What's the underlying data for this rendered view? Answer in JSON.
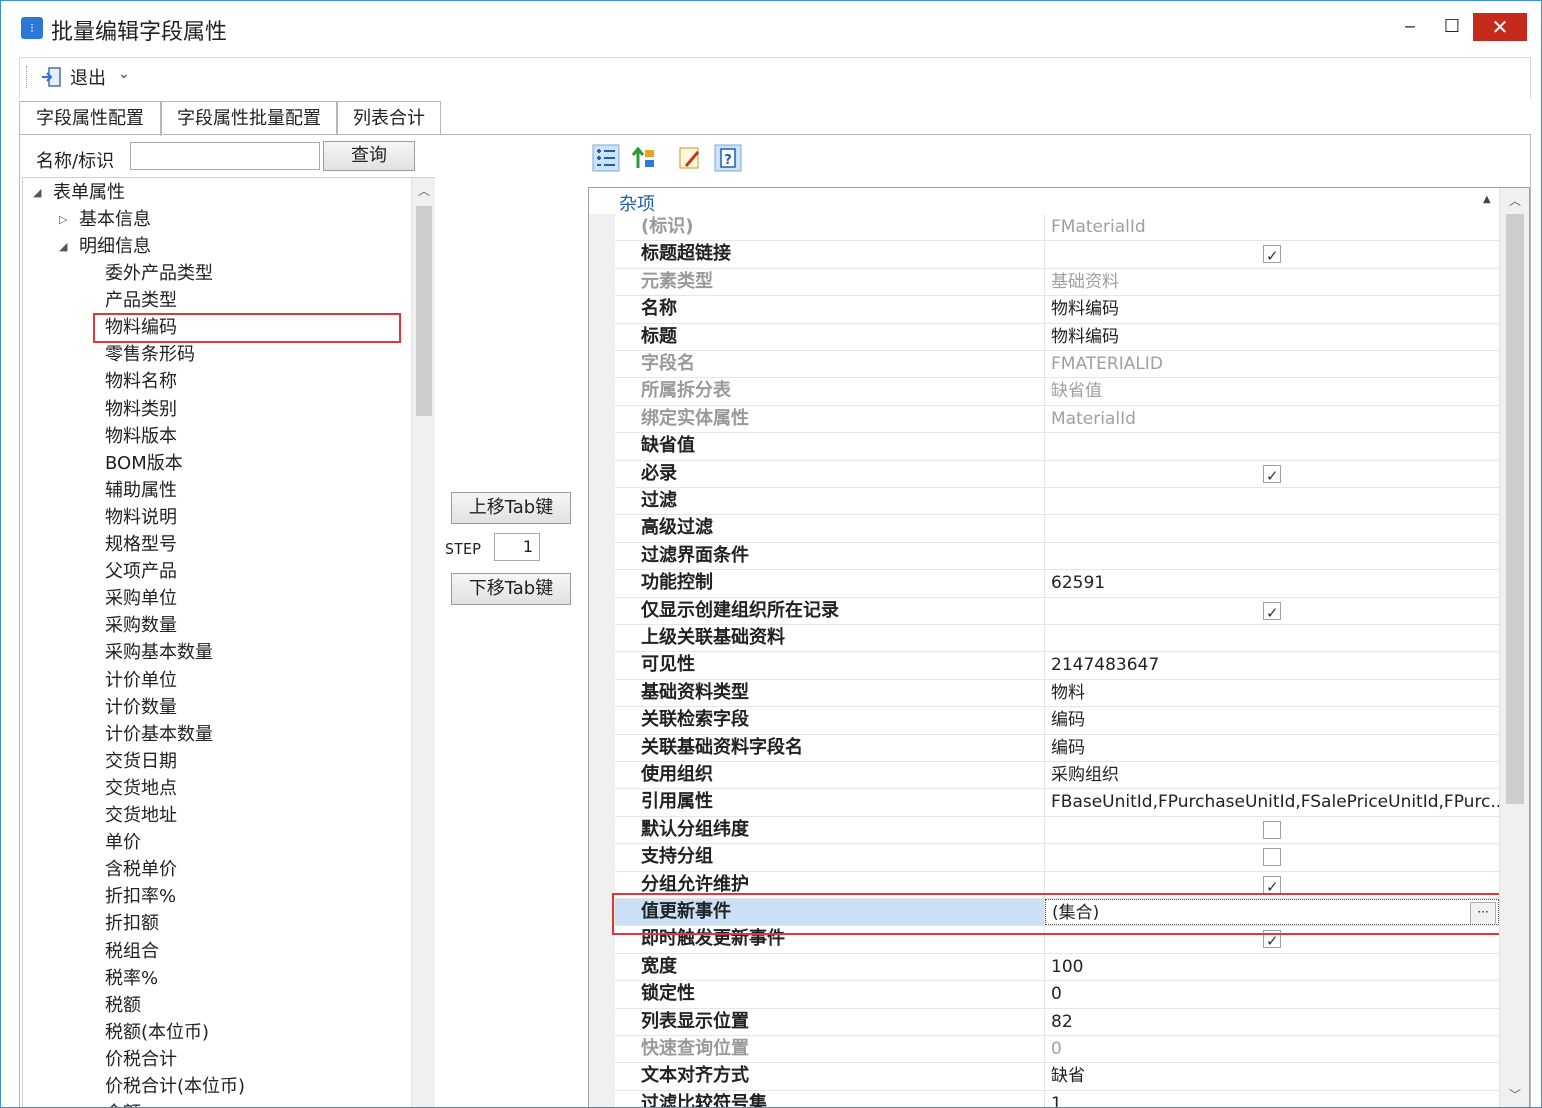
{
  "window": {
    "title": "批量编辑字段属性",
    "minimize": "‒",
    "maximize": "☐",
    "close": "✕"
  },
  "toolbar": {
    "exit_label": "退出",
    "dropdown": "⌄"
  },
  "tabs": [
    "字段属性配置",
    "字段属性批量配置",
    "列表合计"
  ],
  "search": {
    "label": "名称/标识",
    "value": "",
    "button": "查询"
  },
  "tree": {
    "root": "表单属性",
    "groups": [
      "基本信息",
      "明细信息"
    ],
    "selected": "物料编码",
    "items": [
      "委外产品类型",
      "产品类型",
      "物料编码",
      "零售条形码",
      "物料名称",
      "物料类别",
      "物料版本",
      "BOM版本",
      "辅助属性",
      "物料说明",
      "规格型号",
      "父项产品",
      "采购单位",
      "采购数量",
      "采购基本数量",
      "计价单位",
      "计价数量",
      "计价基本数量",
      "交货日期",
      "交货地点",
      "交货地址",
      "单价",
      "含税单价",
      "折扣率%",
      "折扣额",
      "税组合",
      "税率%",
      "税额",
      "税额(本位币)",
      "价税合计",
      "价税合计(本位币)",
      "金额"
    ]
  },
  "mover": {
    "up_button": "上移Tab键",
    "step_label": "STEP",
    "step_value": "1",
    "down_button": "下移Tab键"
  },
  "property_grid": {
    "category": "杂项",
    "rows": [
      {
        "name": "(标识)",
        "value": "FMaterialId",
        "disabled": true
      },
      {
        "name": "标题超链接",
        "check": true
      },
      {
        "name": "元素类型",
        "value": "基础资料",
        "disabled": true
      },
      {
        "name": "名称",
        "value": "物料编码"
      },
      {
        "name": "标题",
        "value": "物料编码"
      },
      {
        "name": "字段名",
        "value": "FMATERIALID",
        "disabled": true
      },
      {
        "name": "所属拆分表",
        "value": "缺省值",
        "disabled": true
      },
      {
        "name": "绑定实体属性",
        "value": "MaterialId",
        "disabled": true
      },
      {
        "name": "缺省值",
        "value": ""
      },
      {
        "name": "必录",
        "check": true
      },
      {
        "name": "过滤",
        "value": ""
      },
      {
        "name": "高级过滤",
        "value": ""
      },
      {
        "name": "过滤界面条件",
        "value": ""
      },
      {
        "name": "功能控制",
        "value": "62591"
      },
      {
        "name": "仅显示创建组织所在记录",
        "check": true
      },
      {
        "name": "上级关联基础资料",
        "value": ""
      },
      {
        "name": "可见性",
        "value": "2147483647"
      },
      {
        "name": "基础资料类型",
        "value": "物料"
      },
      {
        "name": "关联检索字段",
        "value": "编码"
      },
      {
        "name": "关联基础资料字段名",
        "value": "编码"
      },
      {
        "name": "使用组织",
        "value": "采购组织"
      },
      {
        "name": "引用属性",
        "value": "FBaseUnitId,FPurchaseUnitId,FSalePriceUnitId,FPurc..."
      },
      {
        "name": "默认分组纬度",
        "check": false
      },
      {
        "name": "支持分组",
        "check": false
      },
      {
        "name": "分组允许维护",
        "check": true
      },
      {
        "name": "值更新事件",
        "value": "(集合)",
        "selected": true,
        "ellipsis": "···"
      },
      {
        "name": "即时触发更新事件",
        "check": true
      },
      {
        "name": "宽度",
        "value": "100"
      },
      {
        "name": "锁定性",
        "value": "0"
      },
      {
        "name": "列表显示位置",
        "value": "82"
      },
      {
        "name": "快速查询位置",
        "value": "0",
        "disabled": true
      },
      {
        "name": "文本对齐方式",
        "value": "缺省"
      },
      {
        "name": "过滤比较符号集",
        "value": "1"
      }
    ]
  },
  "colors": {
    "highlight": "#e0373d",
    "selection": "#c9e0f7",
    "category": "#1e5fb5"
  }
}
